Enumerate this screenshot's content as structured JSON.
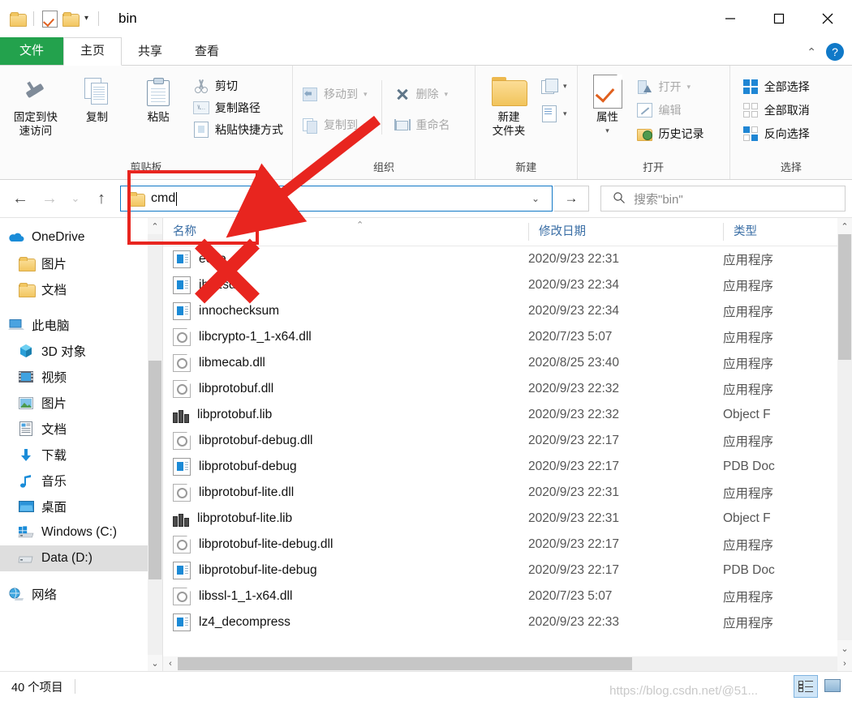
{
  "window": {
    "title": "bin",
    "controls": {
      "minimize": "—",
      "maximize": "□",
      "close": "✕"
    },
    "quick_access": {
      "folder_icon": "folder-icon",
      "properties_icon": "properties-checkmark-icon",
      "new_folder_icon": "folder-icon",
      "customize_caret": "▾"
    }
  },
  "ribbon": {
    "tabs": [
      {
        "label": "文件",
        "name": "tab-file"
      },
      {
        "label": "主页",
        "name": "tab-home"
      },
      {
        "label": "共享",
        "name": "tab-share"
      },
      {
        "label": "查看",
        "name": "tab-view"
      }
    ],
    "collapse_icon": "⌃",
    "help_icon": "?",
    "groups": [
      {
        "label": "剪贴板",
        "name": "group-clipboard",
        "big": [
          {
            "label": "固定到快\n速访问",
            "line1": "固定到快",
            "line2": "速访问",
            "icon": "pin-icon"
          },
          {
            "label": "复制",
            "icon": "copy-pages-icon"
          },
          {
            "label": "粘贴",
            "icon": "clipboard-icon"
          }
        ],
        "small": [
          {
            "label": "剪切",
            "icon": "scissors-icon",
            "disabled": false
          },
          {
            "label": "复制路径",
            "icon": "copy-path-icon",
            "disabled": false
          },
          {
            "label": "粘贴快捷方式",
            "icon": "paste-shortcut-icon",
            "disabled": false
          }
        ]
      },
      {
        "label": "组织",
        "name": "group-organize",
        "small": [
          {
            "label": "移动到",
            "icon": "move-to-icon",
            "caret": "▾",
            "disabled": true
          },
          {
            "label": "复制到",
            "icon": "copy-to-icon",
            "caret": "▾",
            "disabled": true
          },
          {
            "label": "删除",
            "icon": "delete-x-icon",
            "caret": "▾",
            "disabled": true
          },
          {
            "label": "重命名",
            "icon": "rename-icon",
            "disabled": true
          }
        ]
      },
      {
        "label": "新建",
        "name": "group-new",
        "big": [
          {
            "line1": "新建",
            "line2": "文件夹",
            "icon": "new-folder-icon"
          }
        ],
        "small": [
          {
            "label": "",
            "icon": "new-item-icon",
            "caret": "▾"
          },
          {
            "label": "",
            "icon": "easy-access-icon",
            "caret": "▾"
          }
        ]
      },
      {
        "label": "打开",
        "name": "group-open",
        "big": [
          {
            "line1": "属性",
            "icon": "properties-icon",
            "caret": "▾"
          }
        ],
        "small": [
          {
            "label": "打开",
            "icon": "open-icon",
            "caret": "▾",
            "disabled": true
          },
          {
            "label": "编辑",
            "icon": "edit-icon",
            "disabled": true
          },
          {
            "label": "历史记录",
            "icon": "history-icon",
            "disabled": false
          }
        ]
      },
      {
        "label": "选择",
        "name": "group-select",
        "small": [
          {
            "label": "全部选择",
            "icon": "select-all-icon"
          },
          {
            "label": "全部取消",
            "icon": "select-none-icon"
          },
          {
            "label": "反向选择",
            "icon": "invert-selection-icon"
          }
        ]
      }
    ]
  },
  "navbar": {
    "back_icon": "←",
    "forward_icon": "→",
    "recent_icon": "⌄",
    "up_icon": "↑",
    "address_value": "cmd",
    "address_folder_icon": "folder-icon",
    "address_dropdown_icon": "⌄",
    "go_icon": "→",
    "search": {
      "placeholder": "搜索\"bin\"",
      "icon": "search-icon",
      "value": ""
    }
  },
  "sidebar": {
    "items": [
      {
        "label": "OneDrive",
        "icon": "onedrive-cloud-icon",
        "level": 0,
        "selected": false
      },
      {
        "label": "图片",
        "icon": "folder-icon",
        "level": 1,
        "selected": false
      },
      {
        "label": "文档",
        "icon": "folder-icon",
        "level": 1,
        "selected": false
      },
      {
        "label": "此电脑",
        "icon": "this-pc-icon",
        "level": 0,
        "selected": false,
        "gap_before": true
      },
      {
        "label": "3D 对象",
        "icon": "3d-objects-icon",
        "level": 1,
        "selected": false
      },
      {
        "label": "视频",
        "icon": "videos-icon",
        "level": 1,
        "selected": false
      },
      {
        "label": "图片",
        "icon": "pictures-icon",
        "level": 1,
        "selected": false
      },
      {
        "label": "文档",
        "icon": "documents-icon",
        "level": 1,
        "selected": false
      },
      {
        "label": "下载",
        "icon": "downloads-icon",
        "level": 1,
        "selected": false
      },
      {
        "label": "音乐",
        "icon": "music-icon",
        "level": 1,
        "selected": false
      },
      {
        "label": "桌面",
        "icon": "desktop-icon",
        "level": 1,
        "selected": false
      },
      {
        "label": "Windows (C:)",
        "icon": "windows-drive-icon",
        "level": 1,
        "selected": false
      },
      {
        "label": "Data (D:)",
        "icon": "drive-icon",
        "level": 1,
        "selected": true
      },
      {
        "label": "网络",
        "icon": "network-icon",
        "level": 0,
        "selected": false,
        "gap_before": true
      }
    ]
  },
  "filelist": {
    "columns": [
      {
        "label": "名称",
        "name": "column-name"
      },
      {
        "label": "修改日期",
        "name": "column-date-modified"
      },
      {
        "label": "类型",
        "name": "column-type"
      }
    ],
    "sort_indicator": "⌃",
    "rows": [
      {
        "name": "echo",
        "icon": "exe-icon",
        "date": "2020/9/23 22:31",
        "type": "应用程序"
      },
      {
        "name": "ibd2sdi",
        "icon": "exe-icon",
        "date": "2020/9/23 22:34",
        "type": "应用程序"
      },
      {
        "name": "innochecksum",
        "icon": "exe-icon",
        "date": "2020/9/23 22:34",
        "type": "应用程序"
      },
      {
        "name": "libcrypto-1_1-x64.dll",
        "icon": "dll-icon",
        "date": "2020/7/23 5:07",
        "type": "应用程序"
      },
      {
        "name": "libmecab.dll",
        "icon": "dll-icon",
        "date": "2020/8/25 23:40",
        "type": "应用程序"
      },
      {
        "name": "libprotobuf.dll",
        "icon": "dll-icon",
        "date": "2020/9/23 22:32",
        "type": "应用程序"
      },
      {
        "name": "libprotobuf.lib",
        "icon": "lib-icon",
        "date": "2020/9/23 22:32",
        "type": "Object F"
      },
      {
        "name": "libprotobuf-debug.dll",
        "icon": "dll-icon",
        "date": "2020/9/23 22:17",
        "type": "应用程序"
      },
      {
        "name": "libprotobuf-debug",
        "icon": "exe-icon",
        "date": "2020/9/23 22:17",
        "type": "PDB Doc"
      },
      {
        "name": "libprotobuf-lite.dll",
        "icon": "dll-icon",
        "date": "2020/9/23 22:31",
        "type": "应用程序"
      },
      {
        "name": "libprotobuf-lite.lib",
        "icon": "lib-icon",
        "date": "2020/9/23 22:31",
        "type": "Object F"
      },
      {
        "name": "libprotobuf-lite-debug.dll",
        "icon": "dll-icon",
        "date": "2020/9/23 22:17",
        "type": "应用程序"
      },
      {
        "name": "libprotobuf-lite-debug",
        "icon": "exe-icon",
        "date": "2020/9/23 22:17",
        "type": "PDB Doc"
      },
      {
        "name": "libssl-1_1-x64.dll",
        "icon": "dll-icon",
        "date": "2020/7/23 5:07",
        "type": "应用程序"
      },
      {
        "name": "lz4_decompress",
        "icon": "exe-icon",
        "date": "2020/9/23 22:33",
        "type": "应用程序"
      }
    ]
  },
  "status": {
    "item_count": "40 个项目",
    "view_details_icon": "details-view-icon",
    "view_large_icons_icon": "large-icons-view-icon",
    "watermark": "https://blog.csdn.net/@51..."
  },
  "annotations": {
    "highlight_color": "#e8251f",
    "rect_label": "address-bar-highlight",
    "x_label": "cross-out-mark",
    "arrow_label": "pointer-arrow"
  }
}
